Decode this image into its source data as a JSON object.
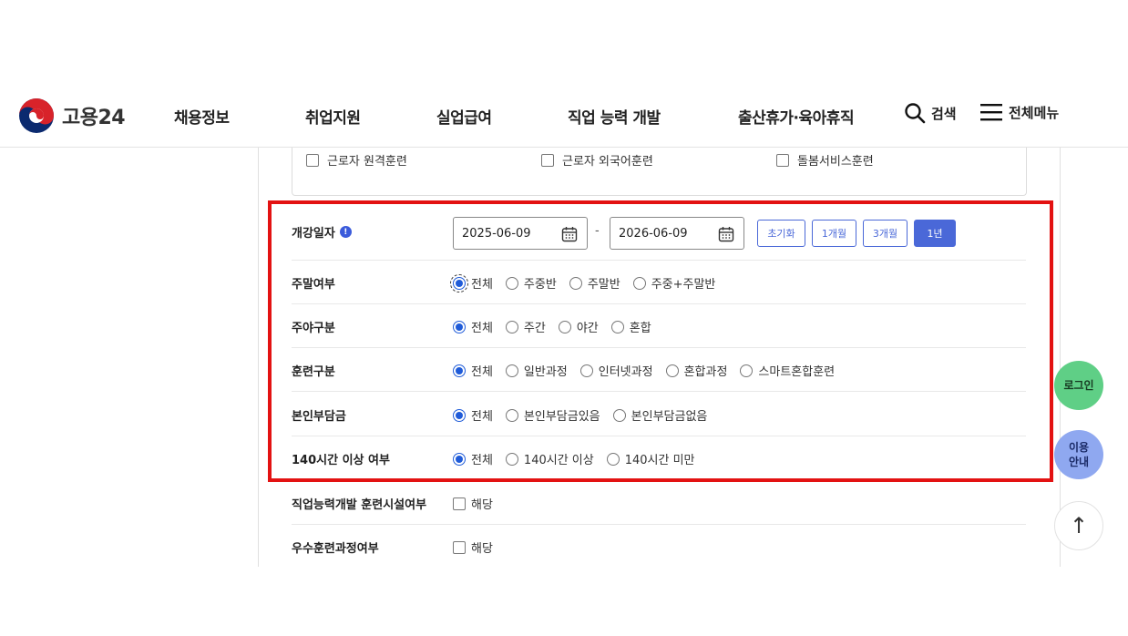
{
  "header": {
    "logo_text": "고용24",
    "nav": [
      "채용정보",
      "취업지원",
      "실업급여",
      "직업 능력 개발",
      "출산휴가·육아휴직"
    ],
    "search_label": "검색",
    "menu_label": "전체메뉴"
  },
  "top_checkboxes": [
    "근로자 원격훈련",
    "근로자 외국어훈련",
    "돌봄서비스훈련"
  ],
  "start_date": {
    "label": "개강일자",
    "info_glyph": "!",
    "from": "2025-06-09",
    "to": "2026-06-09",
    "separator": "-",
    "period_buttons": [
      "초기화",
      "1개월",
      "3개월",
      "1년"
    ],
    "selected_period": "1년"
  },
  "filters": [
    {
      "label": "주말여부",
      "options": [
        "전체",
        "주중반",
        "주말반",
        "주중+주말반"
      ],
      "selected": 0
    },
    {
      "label": "주야구분",
      "options": [
        "전체",
        "주간",
        "야간",
        "혼합"
      ],
      "selected": 0
    },
    {
      "label": "훈련구분",
      "options": [
        "전체",
        "일반과정",
        "인터넷과정",
        "혼합과정",
        "스마트혼합훈련"
      ],
      "selected": 0
    },
    {
      "label": "본인부담금",
      "options": [
        "전체",
        "본인부담금있음",
        "본인부담금없음"
      ],
      "selected": 0
    },
    {
      "label": "140시간 이상 여부",
      "options": [
        "전체",
        "140시간 이상",
        "140시간 미만"
      ],
      "selected": 0
    }
  ],
  "check_filters": [
    {
      "label": "직업능력개발 훈련시설여부",
      "option": "해당"
    },
    {
      "label": "우수훈련과정여부",
      "option": "해당"
    }
  ],
  "floating": {
    "login": "로그인",
    "guide_line1": "이용",
    "guide_line2": "안내",
    "top_glyph": "↑"
  },
  "colors": {
    "accent": "#4a68d8",
    "radio_selected": "#1f5bd8",
    "highlight": "#e31212",
    "login_bg": "#5fcf86",
    "guide_bg": "#8fa8f0"
  }
}
